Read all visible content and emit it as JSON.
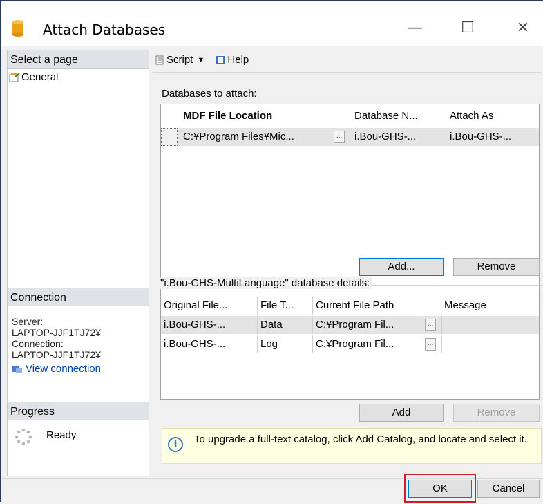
{
  "window": {
    "title": "Attach Databases",
    "minimize_glyph": "—",
    "maximize_glyph": "☐",
    "close_glyph": "✕"
  },
  "left": {
    "select_page": "Select a page",
    "pages": [
      "General"
    ],
    "connection_header": "Connection",
    "server_label": "Server:",
    "server_value": "LAPTOP-JJF1TJ72¥",
    "connection_label": "Connection:",
    "connection_value": "LAPTOP-JJF1TJ72¥",
    "view_connection": "View connection",
    "progress_header": "Progress",
    "progress_status": "Ready"
  },
  "toolbar": {
    "script_label": "Script",
    "script_arrow": "▼",
    "help_label": "Help"
  },
  "attach": {
    "group_label": "Databases to attach:",
    "columns": [
      "MDF File Location",
      "Database N...",
      "Attach As"
    ],
    "rows": [
      {
        "location": "C:¥Program Files¥Mic...",
        "browse": "...",
        "db_name": "i.Bou-GHS-...",
        "attach_as": "i.Bou-GHS-..."
      }
    ],
    "add_label": "Add...",
    "remove_label": "Remove",
    "scroll_left": "‹",
    "scroll_right": "›"
  },
  "details": {
    "group_label": "\"i.Bou-GHS-MultiLanguage\" database details:",
    "columns": [
      "Original File...",
      "File T...",
      "Current File Path",
      "Message"
    ],
    "rows": [
      {
        "original": "i.Bou-GHS-...",
        "type": "Data",
        "path": "C:¥Program Fil...",
        "browse": "...",
        "message": ""
      },
      {
        "original": "i.Bou-GHS-...",
        "type": "Log",
        "path": "C:¥Program Fil...",
        "browse": "...",
        "message": ""
      }
    ],
    "add_label": "Add",
    "remove_label": "Remove"
  },
  "info": {
    "icon_glyph": "i",
    "message": "To upgrade a full-text catalog, click Add Catalog, and locate and select it."
  },
  "footer": {
    "ok_label": "OK",
    "cancel_label": "Cancel"
  },
  "colors": {
    "highlight_box": "#d11a2a",
    "link": "#0645ad",
    "info_background": "#ffffe1"
  }
}
